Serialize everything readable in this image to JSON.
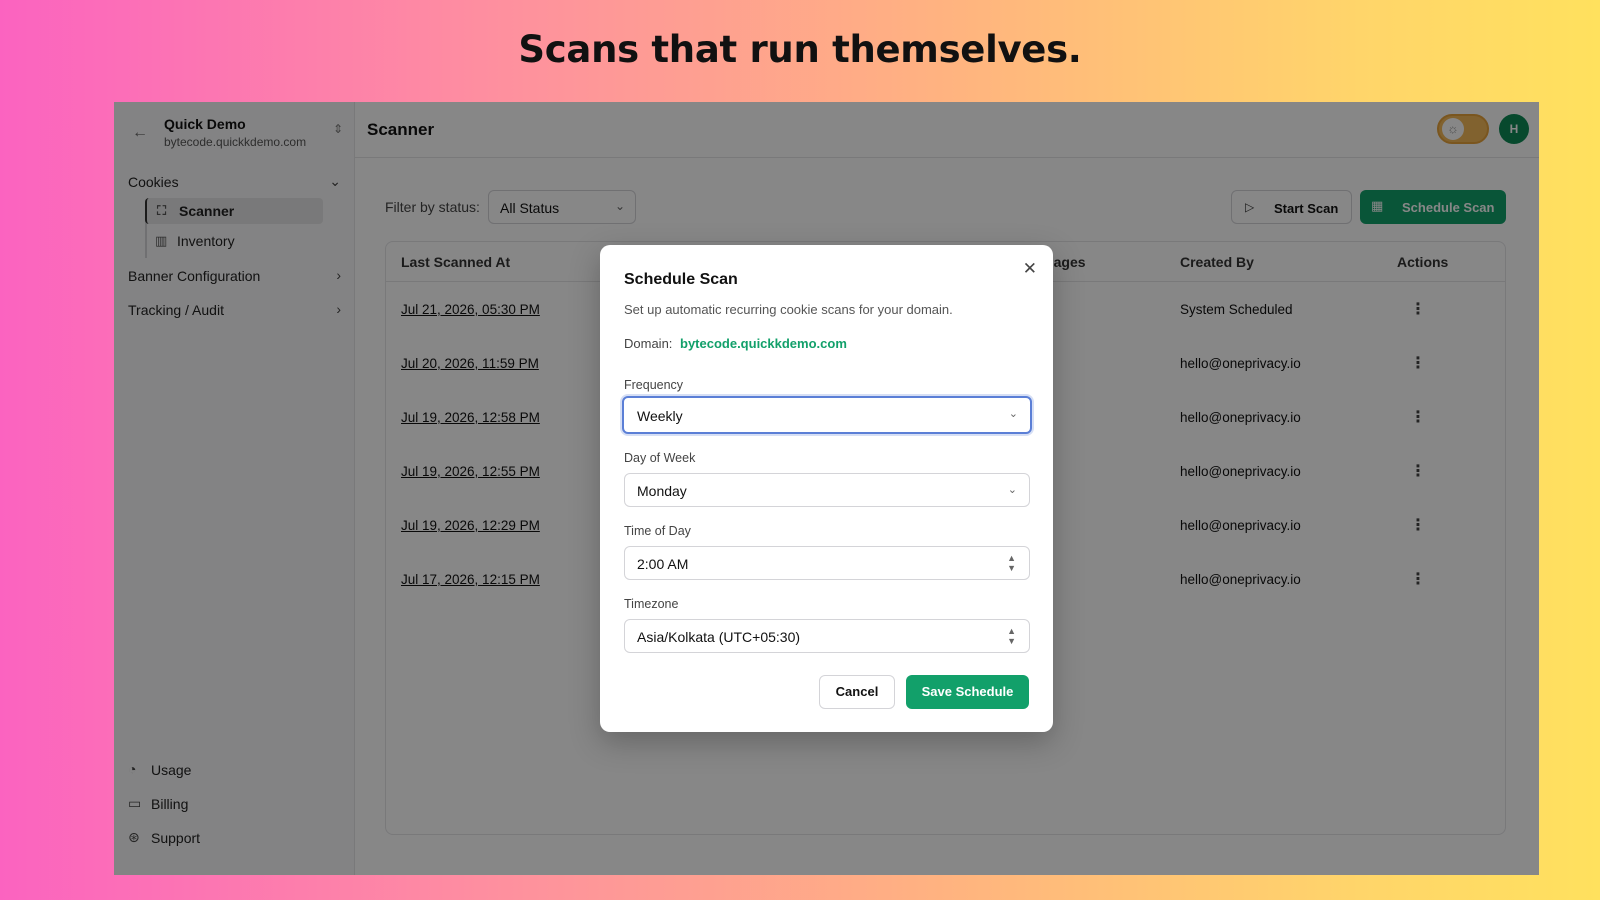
{
  "headline": "Scans that run themselves.",
  "workspace": {
    "name": "Quick Demo",
    "domain": "bytecode.quickkdemo.com"
  },
  "sidebar": {
    "groups": [
      {
        "label": "Cookies",
        "items": [
          {
            "label": "Scanner",
            "active": true
          },
          {
            "label": "Inventory"
          }
        ]
      },
      {
        "label": "Banner Configuration"
      },
      {
        "label": "Tracking / Audit"
      }
    ],
    "footer": [
      {
        "label": "Usage"
      },
      {
        "label": "Billing"
      },
      {
        "label": "Support"
      }
    ]
  },
  "header": {
    "title": "Scanner",
    "avatar_initial": "H"
  },
  "filter": {
    "label": "Filter by status:",
    "value": "All Status"
  },
  "toolbar": {
    "start_label": "Start Scan",
    "schedule_label": "Schedule Scan"
  },
  "table": {
    "columns": [
      "Last Scanned At",
      "Total Pages",
      "Created By",
      "Actions"
    ],
    "rows": [
      {
        "date": "Jul 21, 2026, 05:30 PM",
        "created_by": "System Scheduled"
      },
      {
        "date": "Jul 20, 2026, 11:59 PM",
        "created_by": "hello@oneprivacy.io"
      },
      {
        "date": "Jul 19, 2026, 12:58 PM",
        "created_by": "hello@oneprivacy.io"
      },
      {
        "date": "Jul 19, 2026, 12:55 PM",
        "created_by": "hello@oneprivacy.io"
      },
      {
        "date": "Jul 19, 2026, 12:29 PM",
        "created_by": "hello@oneprivacy.io"
      },
      {
        "date": "Jul 17, 2026, 12:15 PM",
        "created_by": "hello@oneprivacy.io"
      }
    ]
  },
  "modal": {
    "title": "Schedule Scan",
    "description": "Set up automatic recurring cookie scans for your domain.",
    "domain_label": "Domain:",
    "domain_value": "bytecode.quickkdemo.com",
    "fields": [
      {
        "label": "Frequency",
        "value": "Weekly"
      },
      {
        "label": "Day of Week",
        "value": "Monday"
      },
      {
        "label": "Time of Day",
        "value": "2:00 AM"
      },
      {
        "label": "Timezone",
        "value": "Asia/Kolkata (UTC+05:30)"
      }
    ],
    "cancel_label": "Cancel",
    "save_label": "Save Schedule"
  },
  "colors": {
    "accent": "#12a06a",
    "focus": "#5b7fd6",
    "avatar": "#0f8a56",
    "toggle": "#f4b95a"
  },
  "icons": [
    "back-arrow-icon",
    "chevrons-updown-icon",
    "chevron-down-icon",
    "chevron-right-icon",
    "scan-icon",
    "library-icon",
    "gauge-icon",
    "credit-card-icon",
    "lifebuoy-icon",
    "sun-icon",
    "play-icon",
    "calendar-icon",
    "more-vertical-icon",
    "close-icon"
  ]
}
